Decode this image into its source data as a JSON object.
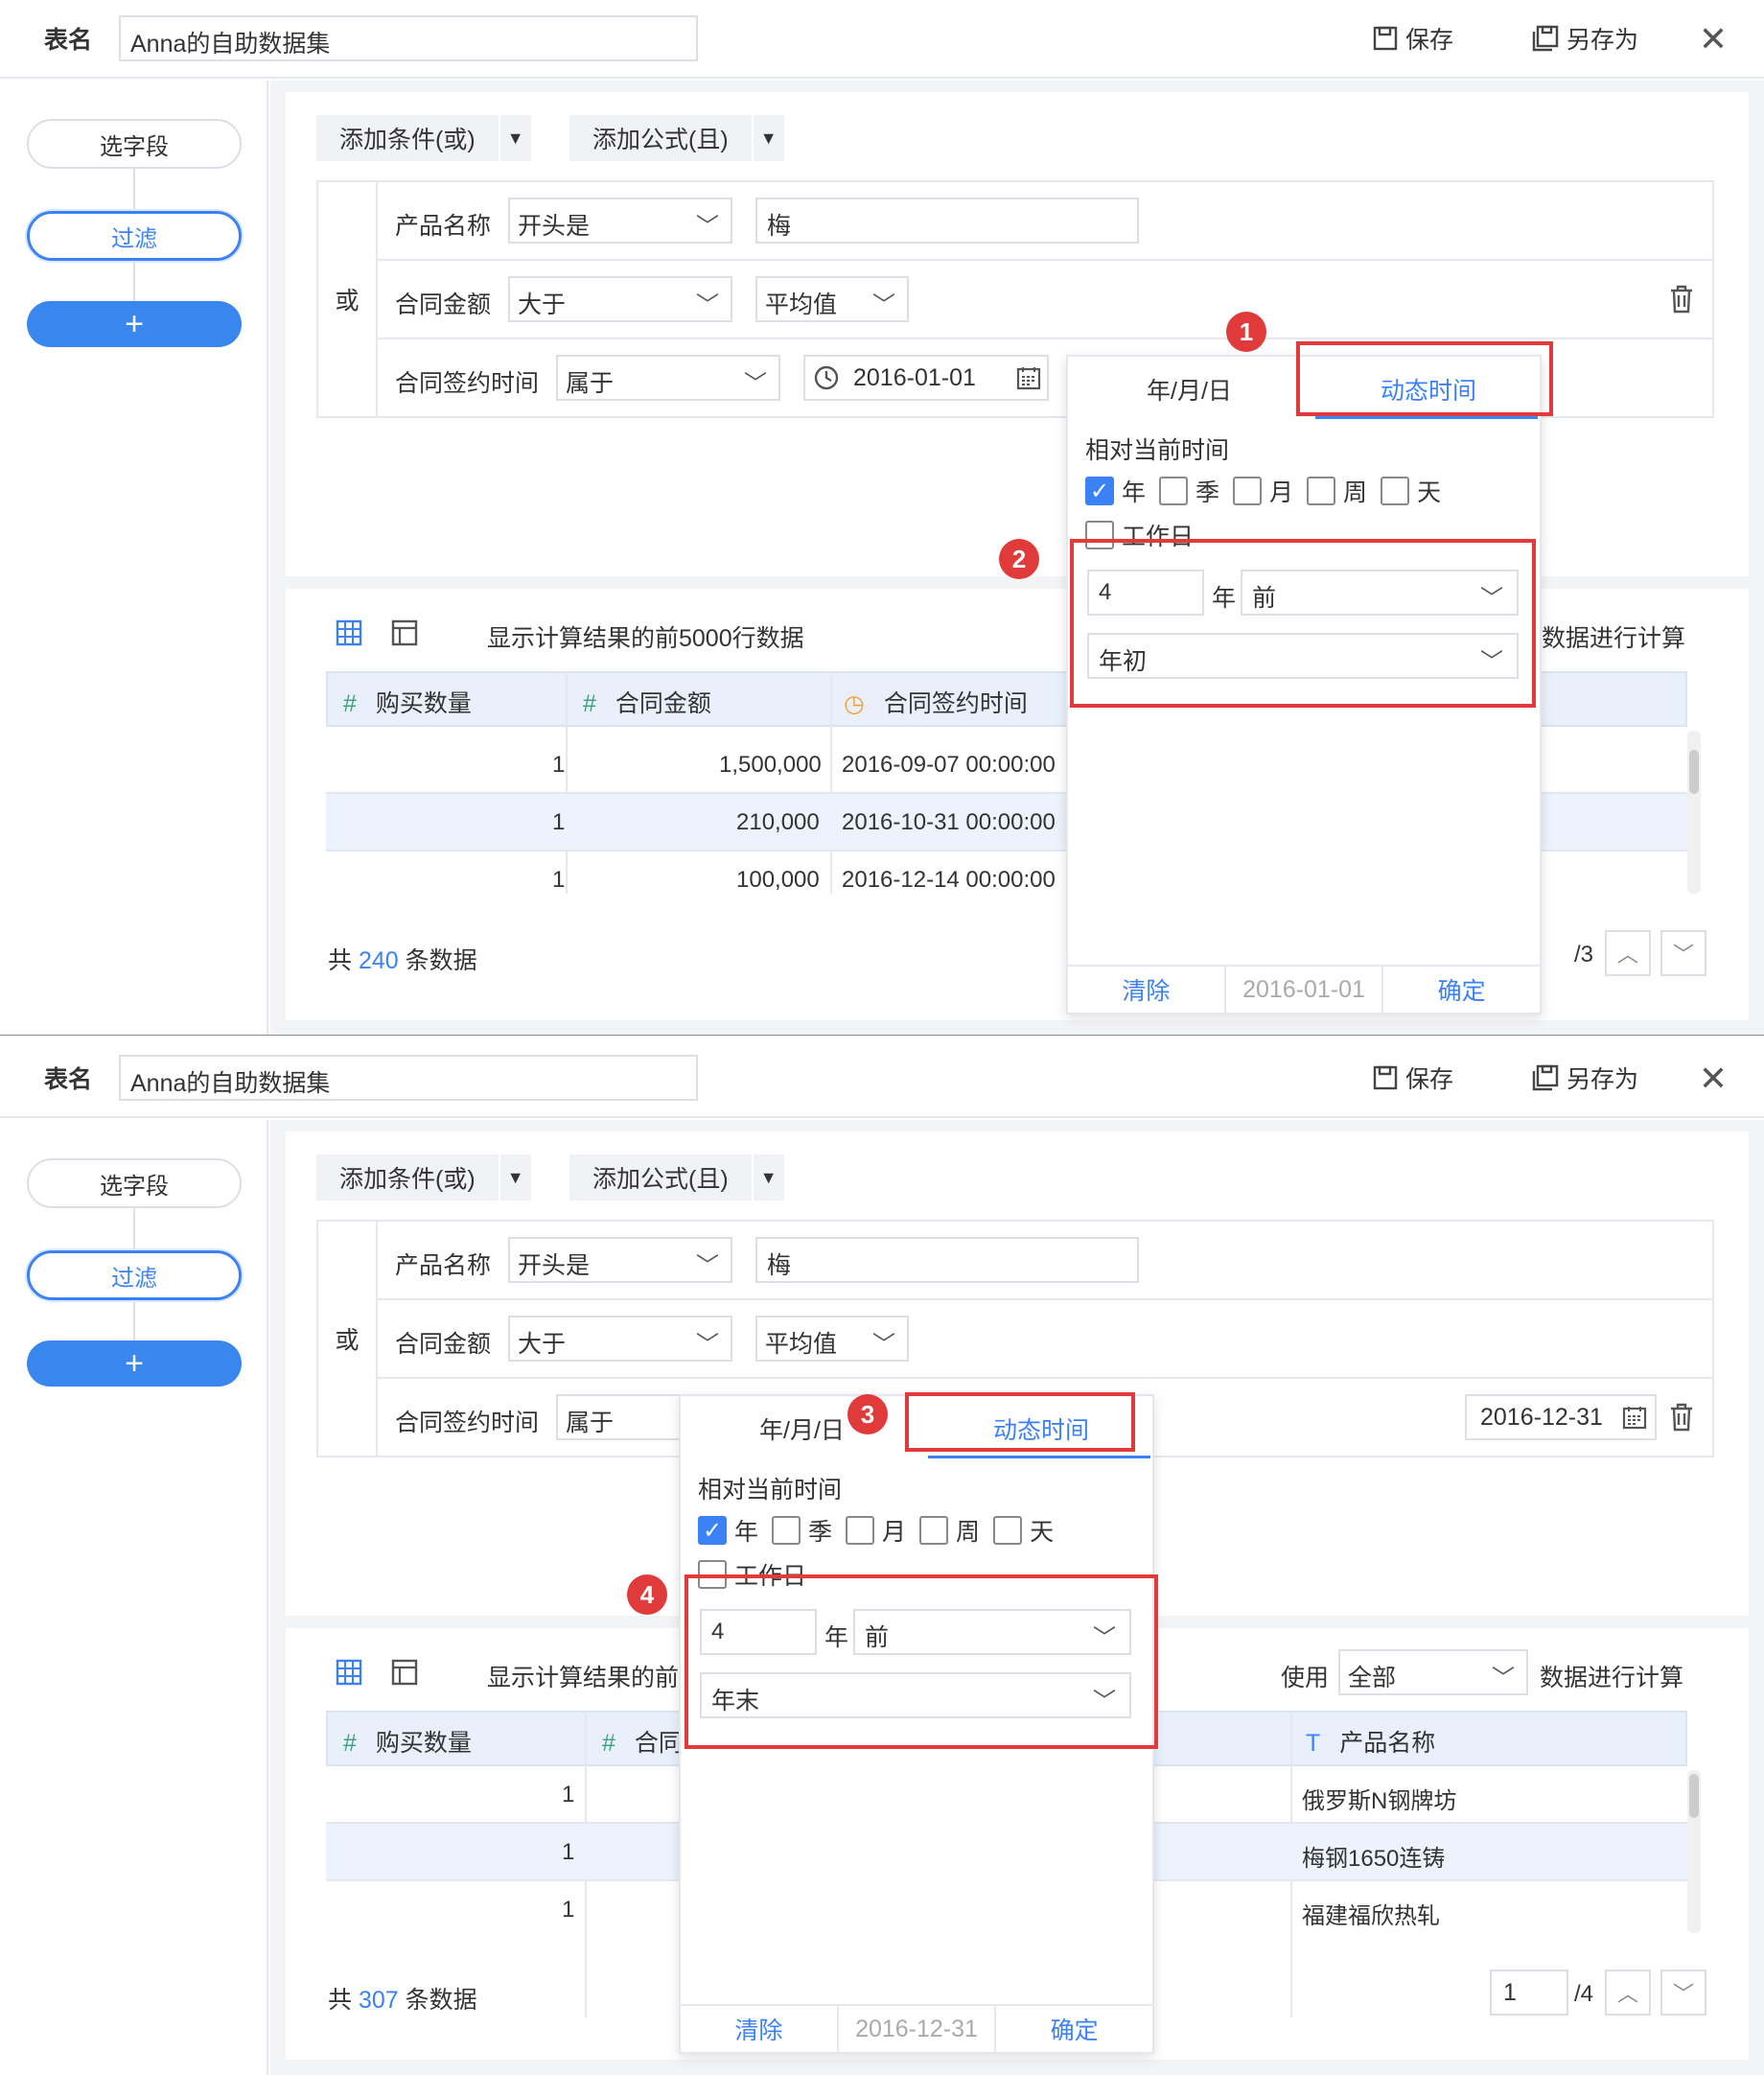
{
  "topbar": {
    "table_label": "表名",
    "table_name": "Anna的自助数据集",
    "save": "保存",
    "save_as": "另存为",
    "close": "✕"
  },
  "steps": {
    "select_fields": "选字段",
    "filter": "过滤",
    "add": "+"
  },
  "toolbar": {
    "add_condition": "添加条件(或)",
    "add_formula": "添加公式(且)"
  },
  "filter": {
    "or_label": "或",
    "rows": [
      {
        "field": "产品名称",
        "op": "开头是",
        "value": "梅"
      },
      {
        "field": "合同金额",
        "op": "大于",
        "value": "平均值"
      },
      {
        "field": "合同签约时间",
        "op": "属于"
      }
    ]
  },
  "info": {
    "show_text": "显示计算结果的前5000行数据",
    "show_text_short": "显示计算结果的前5",
    "use": "使用",
    "use_value": "全部",
    "calc_text": "数据进行计算"
  },
  "panel1": {
    "date_value": "2016-01-01",
    "columns": [
      "购买数量",
      "合同金额",
      "合同签约时间"
    ],
    "rows": [
      [
        "1",
        "1,500,000",
        "2016-09-07 00:00:00"
      ],
      [
        "1",
        "210,000",
        "2016-10-31 00:00:00"
      ],
      [
        "1",
        "100,000",
        "2016-12-14 00:00:00"
      ]
    ],
    "total_prefix": "共",
    "total_count": "240",
    "total_suffix": "条数据",
    "pager_total": "/3",
    "popup": {
      "tab_ymd": "年/月/日",
      "tab_dynamic": "动态时间",
      "relative": "相对当前时间",
      "units": [
        "年",
        "季",
        "月",
        "周",
        "天"
      ],
      "workday": "工作日",
      "num": "4",
      "num_unit": "年",
      "direction": "前",
      "boundary": "年初",
      "clear": "清除",
      "date": "2016-01-01",
      "confirm": "确定"
    },
    "badges": [
      "1",
      "2"
    ]
  },
  "panel2": {
    "date_value": "2016-12-31",
    "columns": [
      "购买数量",
      "合同金额",
      "产品名称"
    ],
    "rows": [
      [
        "1",
        "俄罗斯N钢牌坊"
      ],
      [
        "1",
        "梅钢1650连铸"
      ],
      [
        "1",
        "福建福欣热轧"
      ]
    ],
    "total_prefix": "共",
    "total_count": "307",
    "total_suffix": "条数据",
    "pager_page": "1",
    "pager_total": "/4",
    "popup": {
      "tab_ymd": "年/月/日",
      "tab_dynamic": "动态时间",
      "relative": "相对当前时间",
      "units": [
        "年",
        "季",
        "月",
        "周",
        "天"
      ],
      "workday": "工作日",
      "num": "4",
      "num_unit": "年",
      "direction": "前",
      "boundary": "年末",
      "clear": "清除",
      "date": "2016-12-31",
      "confirm": "确定"
    },
    "badges": [
      "3",
      "4"
    ]
  },
  "icons": {
    "save": "save-icon",
    "save_as": "save-as-icon",
    "close": "close-icon",
    "calendar": "calendar-icon",
    "clock": "clock-icon",
    "trash": "trash-icon",
    "grid": "grid-icon",
    "layout": "layout-icon"
  },
  "colors": {
    "accent": "#3b82f6",
    "highlight": "#e03a3a",
    "pill_blue": "#3a86ef"
  }
}
